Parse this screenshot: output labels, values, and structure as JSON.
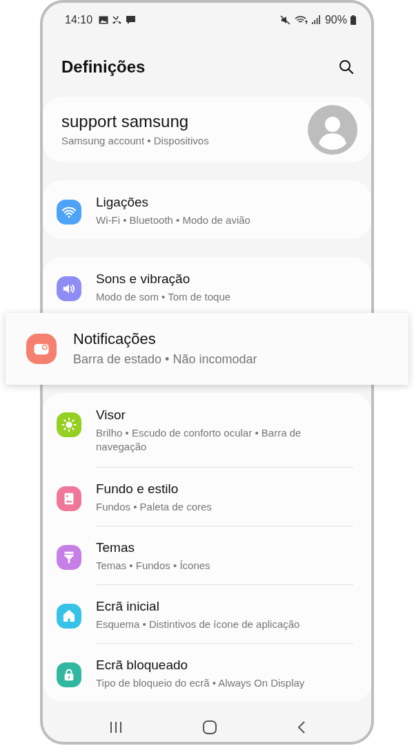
{
  "status_bar": {
    "time": "14:10",
    "battery": "90%"
  },
  "header": {
    "title": "Definições"
  },
  "account": {
    "name": "support samsung",
    "subtitle": "Samsung account • Dispositivos"
  },
  "groups": [
    {
      "items": [
        {
          "title": "Ligações",
          "subtitle": "Wi-Fi • Bluetooth • Modo de avião",
          "color": "#4fa3f7"
        }
      ]
    },
    {
      "items": [
        {
          "title": "Sons e vibração",
          "subtitle": "Modo de som • Tom de toque",
          "color": "#8f8cf5"
        }
      ]
    },
    {
      "items": [
        {
          "title": "Visor",
          "subtitle": "Brilho • Escudo de conforto ocular • Barra de navegação",
          "color": "#95cf22"
        },
        {
          "title": "Fundo e estilo",
          "subtitle": "Fundos • Paleta de cores",
          "color": "#ef7799"
        },
        {
          "title": "Temas",
          "subtitle": "Temas • Fundos • Ícones",
          "color": "#c67fe6"
        },
        {
          "title": "Ecrã inicial",
          "subtitle": "Esquema • Distintivos de ícone de aplicação",
          "color": "#35c3e8"
        },
        {
          "title": "Ecrã bloqueado",
          "subtitle": "Tipo de bloqueio do ecrã • Always On Display",
          "color": "#31b7a0"
        }
      ]
    }
  ],
  "highlighted": {
    "title": "Notificações",
    "subtitle": "Barra de estado • Não incomodar",
    "color": "#f6806f"
  }
}
